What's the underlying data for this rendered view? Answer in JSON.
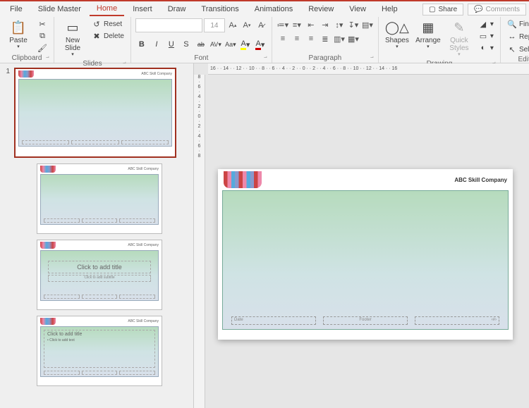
{
  "menu": {
    "file": "File",
    "slide_master": "Slide Master",
    "home": "Home",
    "insert": "Insert",
    "draw": "Draw",
    "transitions": "Transitions",
    "animations": "Animations",
    "review": "Review",
    "view": "View",
    "help": "Help",
    "share": "Share",
    "comments": "Comments"
  },
  "ribbon": {
    "clipboard": {
      "label": "Clipboard",
      "paste": "Paste"
    },
    "slides": {
      "label": "Slides",
      "new_slide": "New\nSlide",
      "reset": "Reset",
      "delete": "Delete"
    },
    "font": {
      "label": "Font",
      "size": "14",
      "b": "B",
      "i": "I",
      "u": "U",
      "s": "S",
      "ab": "ab",
      "av": "AV",
      "aa": "Aa"
    },
    "paragraph": {
      "label": "Paragraph"
    },
    "drawing": {
      "label": "Drawing",
      "shapes": "Shapes",
      "arrange": "Arrange",
      "quick": "Quick\nStyles"
    },
    "editing": {
      "label": "Editing",
      "find": "Find",
      "replace": "Replace",
      "select": "Select"
    }
  },
  "thumbs": {
    "num1": "1",
    "company": "ABC Skill Company",
    "click_title": "Click to add title",
    "click_sub": "Click to add subtitle",
    "click_text": "Click to add text"
  },
  "slide": {
    "company": "ABC Skill Company",
    "date": "Date",
    "footer": "Footer",
    "pg": "‹#›"
  },
  "ruler_h": "16 · · 14 · · 12 · · 10 · · 8 · · 6 · · 4 · · 2 · · 0 · · 2 · · 4 · · 6 · · 8 · · 10 · · 12 · · 14 · · 16",
  "ruler_v": [
    "8",
    "6",
    "4",
    "2",
    "0",
    "2",
    "4",
    "6",
    "8"
  ]
}
